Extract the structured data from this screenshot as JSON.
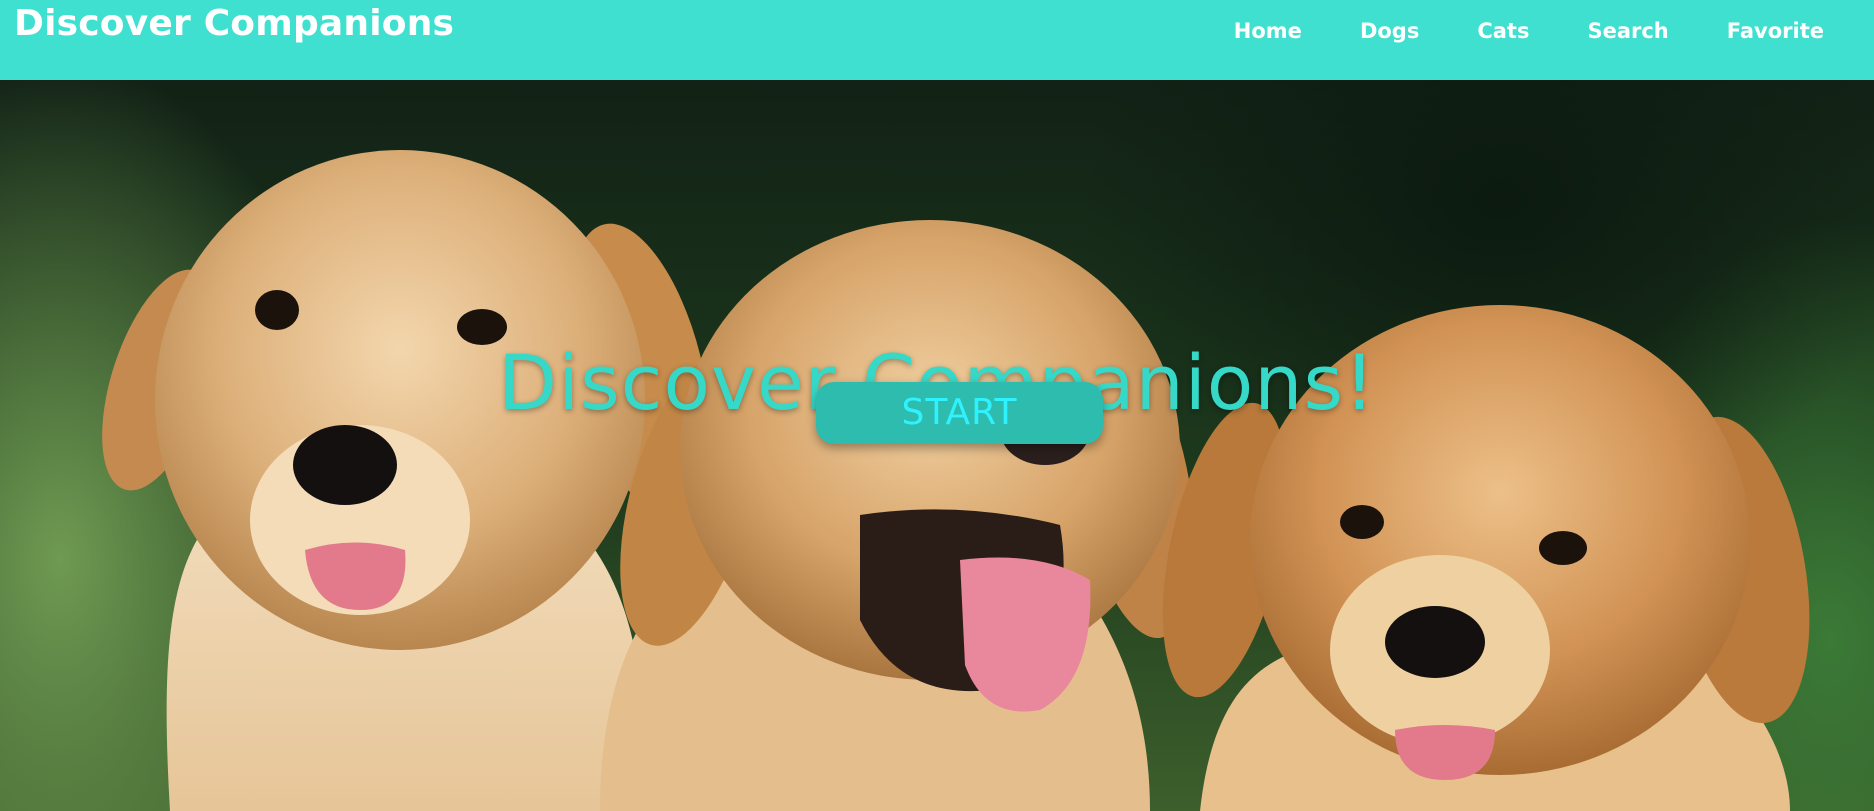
{
  "header": {
    "brand": "Discover Companions",
    "nav": [
      "Home",
      "Dogs",
      "Cats",
      "Search",
      "Favorite"
    ]
  },
  "hero": {
    "title": "Discover Companions!",
    "start_label": "START",
    "image_subject": "three golden retriever puppies"
  },
  "colors": {
    "navbar_bg": "#40e0d0",
    "accent_text": "#36d9c8",
    "button_bg": "#2dbcae",
    "button_text": "#2ff2ff"
  }
}
